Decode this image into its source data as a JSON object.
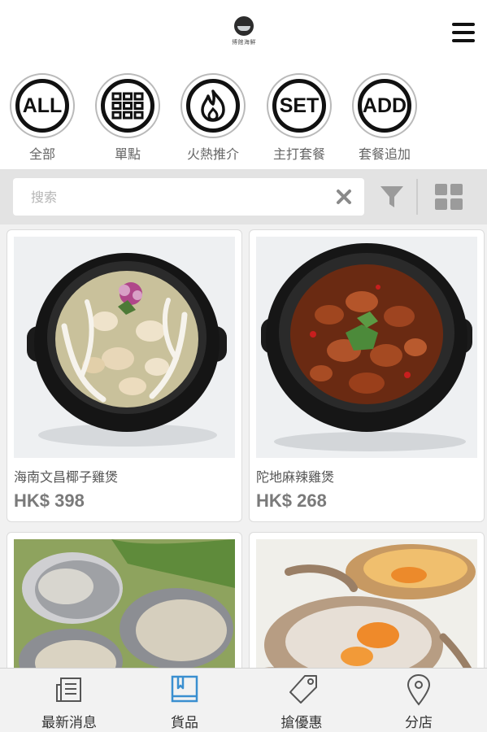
{
  "header": {
    "logo_text": "博館海鮮",
    "menu_icon": "hamburger-icon"
  },
  "categories": [
    {
      "icon_text": "ALL",
      "label": "全部"
    },
    {
      "icon_text": "",
      "icon": "grid-icon",
      "label": "單點"
    },
    {
      "icon_text": "",
      "icon": "flame-icon",
      "label": "火熱推介"
    },
    {
      "icon_text": "SET",
      "label": "主打套餐"
    },
    {
      "icon_text": "ADD",
      "label": "套餐追加"
    }
  ],
  "search": {
    "placeholder": "搜索",
    "value": "",
    "clear_icon": "close-icon",
    "filter_icon": "filter-icon",
    "view_icon": "grid-view-icon"
  },
  "products": [
    {
      "name": "海南文昌椰子雞煲",
      "price": "HK$ 398",
      "image": "coconut-chicken-pot"
    },
    {
      "name": "陀地麻辣雞煲",
      "price": "HK$ 268",
      "image": "spicy-chicken-pot"
    },
    {
      "name": "",
      "price": "",
      "image": "abalone"
    },
    {
      "name": "",
      "price": "",
      "image": "crab"
    }
  ],
  "bottom_nav": [
    {
      "label": "最新消息",
      "icon": "news-icon",
      "active": false
    },
    {
      "label": "貨品",
      "icon": "book-icon",
      "active": true
    },
    {
      "label": "搶優惠",
      "icon": "tag-icon",
      "active": false
    },
    {
      "label": "分店",
      "icon": "location-pin-icon",
      "active": false
    }
  ],
  "colors": {
    "accent": "#3a8fd0",
    "text_dark": "#111111",
    "searchbar_bg": "#e3e3e3"
  }
}
